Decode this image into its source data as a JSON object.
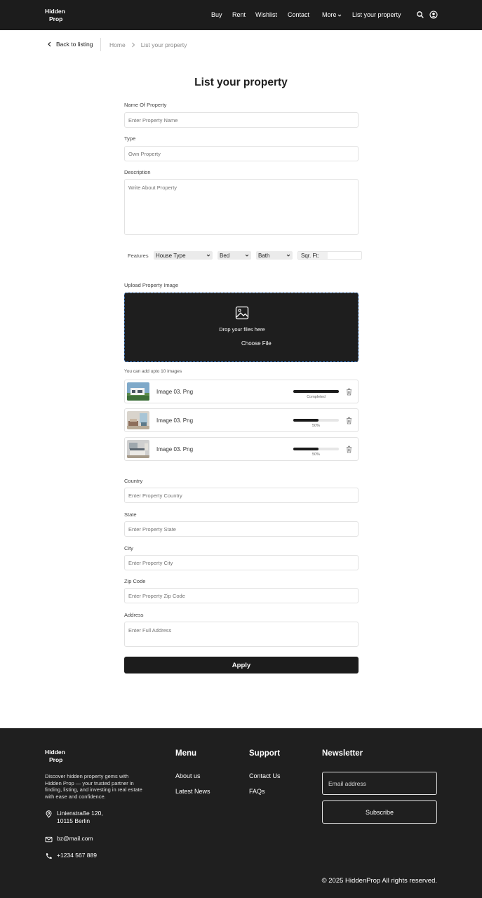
{
  "header": {
    "logo_line1": "Hidden",
    "logo_line2": "Prop",
    "nav": [
      "Buy",
      "Rent",
      "Wishlist",
      "Contact",
      "More",
      "List your property"
    ]
  },
  "breadcrumb": {
    "back_label": "Back to listing",
    "home": "Home",
    "current": "List your property"
  },
  "form": {
    "title": "List your property",
    "name_label": "Name Of Property",
    "name_placeholder": "Enter Property Name",
    "type_label": "Type",
    "type_placeholder": "Own Property",
    "desc_label": "Description",
    "desc_placeholder": "Write About Property",
    "features_label": "Features",
    "house_type": "House Type",
    "bed": "Bed",
    "bath": "Bath",
    "sqft": "Sqr. Ft:",
    "upload_label": "Upload Property Image",
    "drop_text": "Drop your files here",
    "choose_file": "Choose File",
    "upload_hint": "You can add upto 10 images",
    "files": [
      {
        "name": "Image 03. Png",
        "status": "Completed",
        "progress": 1.0
      },
      {
        "name": "Image 03. Png",
        "status": "50%",
        "progress": 0.55
      },
      {
        "name": "Image 03. Png",
        "status": "50%",
        "progress": 0.55
      }
    ],
    "country_label": "Country",
    "country_placeholder": "Enter Property Country",
    "state_label": "State",
    "state_placeholder": "Enter Property State",
    "city_label": "City",
    "city_placeholder": "Enter Property City",
    "zip_label": "Zip Code",
    "zip_placeholder": "Enter Property Zip Code",
    "address_label": "Address",
    "address_placeholder": "Enter Full Address",
    "apply_label": "Apply"
  },
  "footer": {
    "logo_line1": "Hidden",
    "logo_line2": "Prop",
    "description": "Discover hidden property gems with Hidden Prop — your trusted partner in finding, listing, and investing in real estate with ease and confidence.",
    "address_line1": "Linienstraße 120,",
    "address_line2": "10115 Berlin",
    "email": "bz@mail.com",
    "phone": "+1234 567 889",
    "menu_title": "Menu",
    "menu_items": [
      "About us",
      "Latest News"
    ],
    "support_title": "Support",
    "support_items": [
      "Contact Us",
      "FAQs"
    ],
    "newsletter_title": "Newsletter",
    "email_placeholder": "Email address",
    "subscribe_label": "Subscribe",
    "copyright": "© 2025 HiddenProp All rights reserved."
  }
}
